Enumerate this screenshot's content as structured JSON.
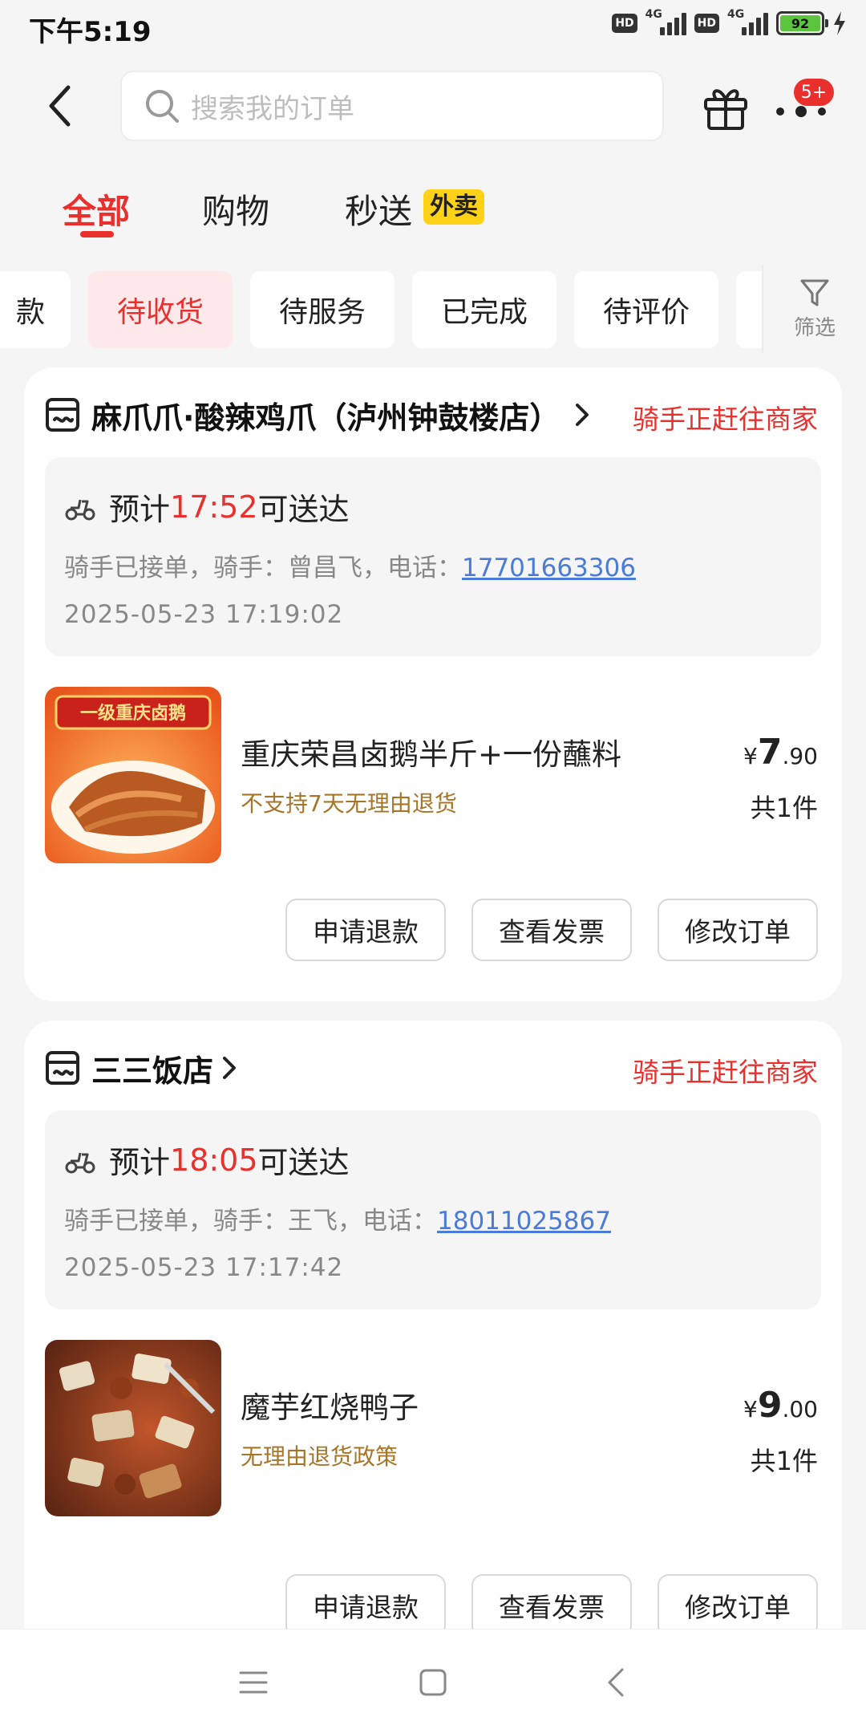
{
  "status_bar": {
    "time": "下午5:19",
    "hd1": "HD",
    "net1": "4G",
    "hd2": "HD",
    "net2": "4G",
    "battery": "92"
  },
  "search": {
    "placeholder": "搜索我的订单"
  },
  "notification_badge": "5+",
  "main_tabs": [
    {
      "label": "全部",
      "active": true
    },
    {
      "label": "购物"
    },
    {
      "label": "秒送",
      "badge": "外卖"
    }
  ],
  "status_filters": [
    {
      "label": "款"
    },
    {
      "label": "待收货",
      "active": true
    },
    {
      "label": "待服务"
    },
    {
      "label": "已完成"
    },
    {
      "label": "待评价"
    }
  ],
  "filter_label": "筛选",
  "orders": [
    {
      "store": "麻爪爪·酸辣鸡爪（泸州钟鼓楼店）",
      "status": "骑手正赶往商家",
      "eta_prefix": "预计",
      "eta_time": "17:52",
      "eta_suffix": "可送达",
      "rider_text": "骑手已接单，骑手：曾昌飞，电话：",
      "rider_phone": "17701663306",
      "order_time": "2025-05-23 17:19:02",
      "product_name": "重庆荣昌卤鹅半斤+一份蘸料",
      "product_policy": "不支持7天无理由退货",
      "image_banner": "一级重庆卤鹅",
      "price_currency": "¥",
      "price_int": "7",
      "price_dec": ".90",
      "quantity": "共1件",
      "actions": [
        "申请退款",
        "查看发票",
        "修改订单"
      ]
    },
    {
      "store": "三三饭店",
      "status": "骑手正赶往商家",
      "eta_prefix": "预计",
      "eta_time": "18:05",
      "eta_suffix": "可送达",
      "rider_text": "骑手已接单，骑手：王飞，电话：",
      "rider_phone": "18011025867",
      "order_time": "2025-05-23 17:17:42",
      "product_name": "魔芋红烧鸭子",
      "product_policy": "无理由退货政策",
      "price_currency": "¥",
      "price_int": "9",
      "price_dec": ".00",
      "quantity": "共1件",
      "actions": [
        "申请退款",
        "查看发票",
        "修改订单"
      ]
    }
  ],
  "colors": {
    "accent": "#e9302d",
    "policy": "#a77528",
    "link": "#4a7bd8",
    "badge_yellow": "#ffd217"
  },
  "icons": [
    "back-arrow-icon",
    "search-icon",
    "gift-icon",
    "more-icon",
    "filter-icon",
    "store-icon",
    "chevron-right-icon",
    "scooter-icon",
    "menu-icon",
    "home-square-icon",
    "back-triangle-icon"
  ]
}
